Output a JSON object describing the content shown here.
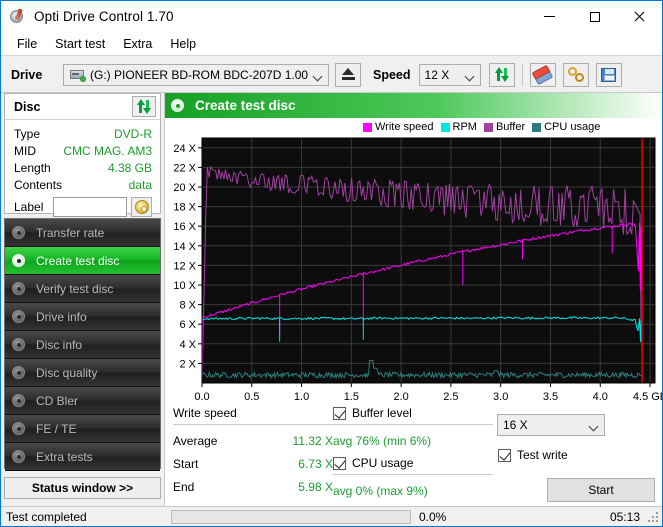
{
  "window": {
    "title": "Opti Drive Control 1.70",
    "icon": "disc-pen-icon",
    "minimize": "minimize-icon",
    "maximize": "maximize-icon",
    "close": "close-icon"
  },
  "menu": {
    "items": [
      "File",
      "Start test",
      "Extra",
      "Help"
    ]
  },
  "toolbar": {
    "drive_label": "Drive",
    "drive_value": "(G:)   PIONEER BD-ROM  BDC-207D 1.00",
    "eject_title": "Eject",
    "speed_label": "Speed",
    "speed_value": "12 X",
    "refresh_title": "Refresh",
    "erase_title": "Erase disc",
    "link_title": "Bitsetting",
    "save_title": "Save"
  },
  "disc": {
    "header": "Disc",
    "refresh_icon": "refresh-icon",
    "rows": [
      {
        "key": "Type",
        "value": "DVD-R"
      },
      {
        "key": "MID",
        "value": "CMC MAG. AM3"
      },
      {
        "key": "Length",
        "value": "4.38 GB"
      },
      {
        "key": "Contents",
        "value": "data"
      }
    ],
    "label_key": "Label",
    "label_value": "",
    "label_placeholder": ""
  },
  "sidebar": {
    "items": [
      {
        "label": "Transfer rate",
        "active": false
      },
      {
        "label": "Create test disc",
        "active": true
      },
      {
        "label": "Verify test disc",
        "active": false
      },
      {
        "label": "Drive info",
        "active": false
      },
      {
        "label": "Disc info",
        "active": false
      },
      {
        "label": "Disc quality",
        "active": false
      },
      {
        "label": "CD Bler",
        "active": false
      },
      {
        "label": "FE / TE",
        "active": false
      },
      {
        "label": "Extra tests",
        "active": false
      }
    ],
    "status_window_button": "Status window >>"
  },
  "main": {
    "header": "Create test disc"
  },
  "stats": {
    "write_speed_header": "Write speed",
    "rows": [
      {
        "key": "Average",
        "value": "11.32 X"
      },
      {
        "key": "Start",
        "value": "6.73 X"
      },
      {
        "key": "End",
        "value": "5.98 X"
      }
    ],
    "buffer_label": "Buffer level",
    "buffer_checked": true,
    "buffer_value": "avg 76% (min 6%)",
    "cpu_label": "CPU usage",
    "cpu_checked": true,
    "cpu_value": "avg 0% (max 9%)",
    "speed_value": "16 X",
    "test_write_label": "Test write",
    "test_write_checked": true,
    "start_button": "Start"
  },
  "statusbar": {
    "text": "Test completed",
    "percent": "0.0%",
    "progress": 0,
    "time": "05:13"
  },
  "colors": {
    "write_speed": "#ff00ff",
    "rpm": "#00e5e5",
    "buffer": "#a040a0",
    "cpu": "#2e7d7d",
    "accent_green": "#15a024",
    "value_green": "#1f9c30",
    "marker_red": "#e00000",
    "plot_bg": "#0d0d0d",
    "plot_grid": "#3a3a3a"
  },
  "chart_data": {
    "type": "line",
    "title": "Create test disc",
    "xlabel": "GB",
    "ylabel": "X",
    "xlim": [
      0.0,
      4.55
    ],
    "ylim": [
      0,
      25
    ],
    "xticks": [
      0.0,
      0.5,
      1.0,
      1.5,
      2.0,
      2.5,
      3.0,
      3.5,
      4.0,
      4.5
    ],
    "xticklabels": [
      "0.0",
      "0.5",
      "1.0",
      "1.5",
      "2.0",
      "2.5",
      "3.0",
      "3.5",
      "4.0",
      "4.5 GB"
    ],
    "yticks": [
      2,
      4,
      6,
      8,
      10,
      12,
      14,
      16,
      18,
      20,
      22,
      24
    ],
    "yticklabels": [
      "2 X",
      "4 X",
      "6 X",
      "8 X",
      "10 X",
      "12 X",
      "14 X",
      "16 X",
      "18 X",
      "20 X",
      "22 X",
      "24 X"
    ],
    "grid": true,
    "legend_position": "top",
    "end_marker_x": 4.42,
    "series": [
      {
        "name": "Write speed",
        "color": "#ff00ff",
        "unit": "X",
        "x": [
          0.0,
          0.05,
          0.15,
          0.3,
          0.45,
          0.6,
          0.75,
          0.9,
          1.05,
          1.2,
          1.35,
          1.5,
          1.65,
          1.8,
          1.95,
          2.1,
          2.25,
          2.4,
          2.55,
          2.7,
          2.85,
          3.0,
          3.15,
          3.3,
          3.45,
          3.6,
          3.75,
          3.9,
          4.05,
          4.2,
          4.35,
          4.42
        ],
        "y": [
          6.73,
          6.8,
          7.1,
          7.55,
          8.0,
          8.45,
          8.9,
          9.3,
          9.7,
          10.1,
          10.45,
          10.85,
          11.2,
          11.55,
          11.9,
          12.25,
          12.6,
          12.9,
          13.25,
          13.55,
          13.85,
          14.1,
          14.4,
          14.7,
          14.95,
          15.2,
          15.45,
          15.7,
          15.9,
          16.1,
          16.3,
          5.98
        ]
      },
      {
        "name": "RPM",
        "color": "#00e5e5",
        "unit": "X",
        "x": [
          0.0,
          0.3,
          0.6,
          0.9,
          1.2,
          1.5,
          1.8,
          2.1,
          2.4,
          2.7,
          3.0,
          3.3,
          3.6,
          3.9,
          4.2,
          4.35,
          4.42
        ],
        "y": [
          6.55,
          6.58,
          6.6,
          6.58,
          6.6,
          6.55,
          6.62,
          6.6,
          6.62,
          6.6,
          6.65,
          6.62,
          6.65,
          6.62,
          6.65,
          6.4,
          3.8
        ]
      },
      {
        "name": "Buffer",
        "color": "#a040a0",
        "unit": "%",
        "x": [
          0.0,
          0.05,
          0.2,
          0.4,
          0.6,
          0.8,
          1.0,
          1.2,
          1.4,
          1.6,
          1.8,
          2.0,
          2.2,
          2.4,
          2.6,
          2.8,
          3.0,
          3.2,
          3.4,
          3.6,
          3.8,
          4.0,
          4.2,
          4.35,
          4.42
        ],
        "y": [
          0.0,
          21.6,
          21.2,
          20.9,
          20.6,
          20.4,
          20.2,
          20.0,
          19.8,
          19.6,
          19.4,
          19.2,
          19.0,
          18.8,
          18.6,
          18.5,
          18.3,
          18.2,
          18.1,
          18.0,
          17.9,
          17.8,
          17.7,
          17.2,
          5.0
        ]
      },
      {
        "name": "CPU usage",
        "color": "#2e7d7d",
        "unit": "%",
        "x": [
          0.0,
          0.3,
          0.6,
          0.9,
          1.2,
          1.5,
          1.7,
          1.8,
          2.1,
          2.4,
          2.7,
          3.0,
          3.3,
          3.6,
          3.9,
          4.2,
          4.42
        ],
        "y": [
          0.6,
          0.7,
          0.55,
          0.65,
          0.6,
          0.7,
          2.2,
          0.7,
          0.6,
          0.65,
          0.55,
          0.7,
          0.6,
          0.75,
          0.6,
          0.65,
          0.6
        ]
      }
    ],
    "legend": [
      {
        "label": "Write speed",
        "color": "#ff00ff"
      },
      {
        "label": "RPM",
        "color": "#00e5e5"
      },
      {
        "label": "Buffer",
        "color": "#a040a0"
      },
      {
        "label": "CPU usage",
        "color": "#2e7d7d"
      }
    ]
  }
}
